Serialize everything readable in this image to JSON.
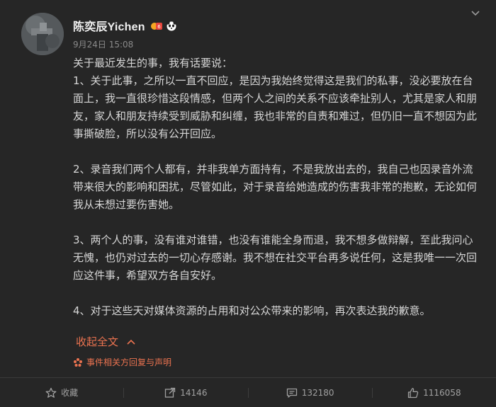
{
  "post": {
    "author": "陈奕辰Yichen",
    "time": "9月24日 15:08",
    "paragraphs": [
      "关于最近发生的事，我有话要说：\n1、关于此事，之所以一直不回应，是因为我始终觉得这是我们的私事，没必要放在台面上，我一直很珍惜这段情感，但两个人之间的关系不应该牵扯别人，尤其是家人和朋友，家人和朋友持续受到威胁和纠缠，我也非常的自责和难过，但仍旧一直不想因为此事撕破脸，所以没有公开回应。",
      "2、录音我们两个人都有，并非我单方面持有，不是我放出去的，我自己也因录音外流带来很大的影响和困扰，尽管如此，对于录音给她造成的伤害我非常的抱歉，无论如何我从未想过要伤害她。",
      "3、两个人的事，没有谁对谁错，也没有谁能全身而退，我不想多做辩解，至此我问心无愧，也仍对过去的一切心存感谢。我不想在社交平台再多说任何，这是我唯一一次回应这件事，希望双方各自安好。",
      "4、对于这些天对媒体资源的占用和对公众带来的影响，再次表达我的歉意。"
    ],
    "collapse_label": "收起全文",
    "related_label": "事件相关方回复与声明"
  },
  "actions": {
    "favorite": "收藏",
    "repost": "14146",
    "comment": "132180",
    "like": "1116058"
  },
  "colors": {
    "background": "#262626",
    "accent": "#eb7350",
    "text": "#d6d6d6",
    "muted": "#8a8a8a"
  },
  "icons": [
    "more-chevron-icon",
    "avatar",
    "vip-badge-icon",
    "panda-icon",
    "collapse-up-icon",
    "related-star-icon",
    "star-icon",
    "repost-icon",
    "comment-icon",
    "like-icon"
  ]
}
